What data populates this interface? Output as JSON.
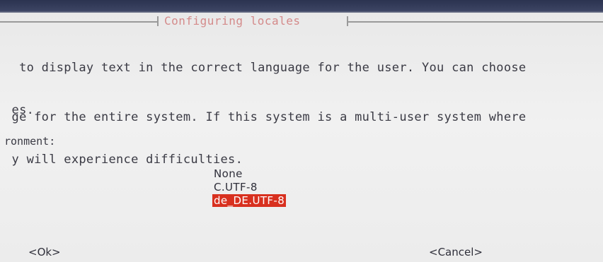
{
  "dialog": {
    "title": "Configuring locales",
    "text_line_1": "  to display text in the correct language for the user. You can choose",
    "text_line_2": " es.",
    "text_line_3": " ge for the entire system. If this system is a multi-user system where",
    "text_line_4": " y will experience difficulties.",
    "prompt": "ronment:"
  },
  "locale_list": {
    "options": [
      "None",
      "C.UTF-8",
      "de_DE.UTF-8"
    ],
    "selected_index": 2,
    "selected_color": "#d8301f"
  },
  "buttons": {
    "ok": "<Ok>",
    "cancel": "<Cancel>"
  }
}
